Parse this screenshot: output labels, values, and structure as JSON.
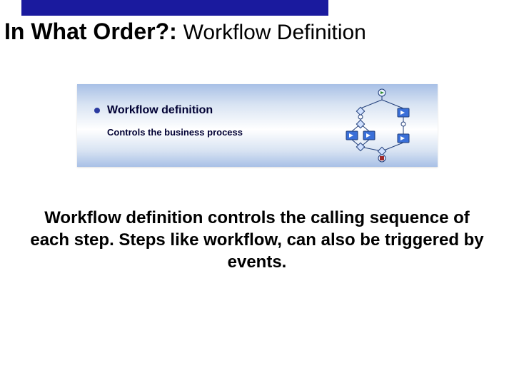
{
  "title": {
    "bold": "In What Order?:",
    "regular": "Workflow Definition"
  },
  "panel": {
    "heading": "Workflow definition",
    "subtitle": "Controls the business process"
  },
  "body": "Workflow definition controls the calling sequence of each step. Steps like workflow, can also be triggered by events.",
  "colors": {
    "titlebar": "#1a1a9e",
    "node_blue": "#3a6fd8",
    "node_border": "#1f3c78"
  }
}
